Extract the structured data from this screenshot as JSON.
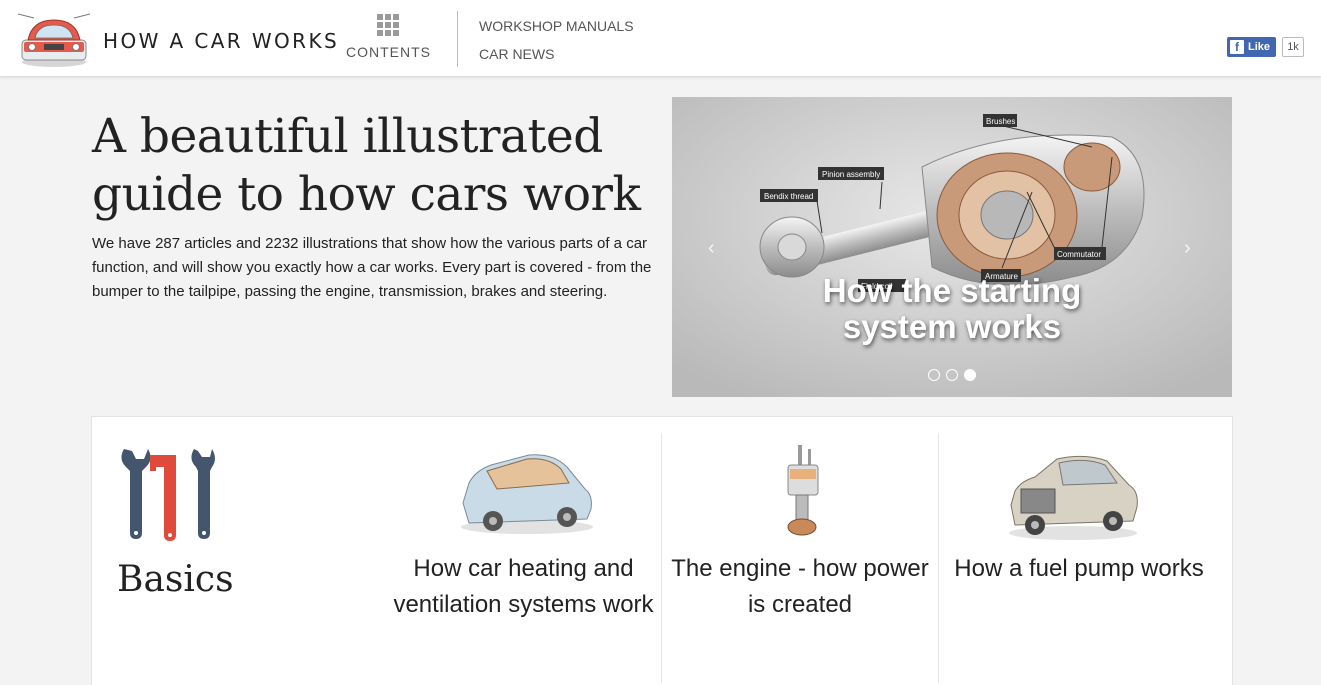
{
  "header": {
    "brand": "HOW A CAR WORKS",
    "contents_label": "CONTENTS",
    "nav": [
      "WORKSHOP MANUALS",
      "CAR NEWS"
    ],
    "fb_like": "Like",
    "fb_count": "1k"
  },
  "hero": {
    "title": "A beautiful illustrated guide to how cars work",
    "text": "We have 287 articles and 2232 illustrations that show how the various parts of a car function, and will show you exactly how a car works. Every part is covered - from the bumper to the tailpipe, passing the engine, transmission, brakes and steering."
  },
  "carousel": {
    "caption": "How the starting system works",
    "labels": [
      "Brushes",
      "Pinion assembly",
      "Bendix thread",
      "Commutator",
      "Armature",
      "Field coil"
    ],
    "active_slide": 3,
    "slide_count": 3
  },
  "cards": [
    {
      "title": "Basics"
    },
    {
      "title": "How car heating and ventilation systems work"
    },
    {
      "title": "The engine - how power is created"
    },
    {
      "title": "How a fuel pump works"
    }
  ],
  "colors": {
    "accent_red": "#e04a3a",
    "tool_blue": "#44556e",
    "fb_blue": "#4267b2"
  }
}
